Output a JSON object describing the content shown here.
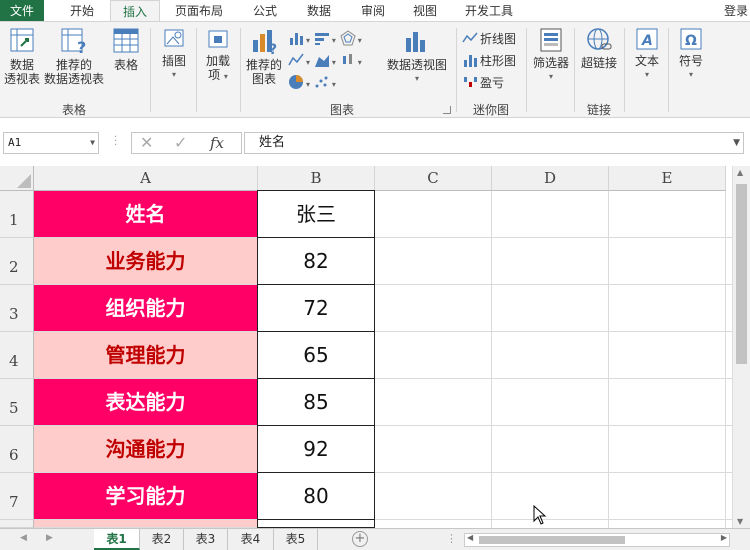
{
  "ribbon_tabs": [
    "文件",
    "开始",
    "插入",
    "页面布局",
    "公式",
    "数据",
    "审阅",
    "视图",
    "开发工具"
  ],
  "login": "登录",
  "groups": {
    "table": {
      "label": "表格",
      "pivot_line1": "数据",
      "pivot_line2": "透视表",
      "rec_pivot_line1": "推荐的",
      "rec_pivot_line2": "数据透视表",
      "table": "表格"
    },
    "illustrations": {
      "label": "插图"
    },
    "addins": {
      "line1": "加载",
      "line2": "项"
    },
    "charts": {
      "label": "图表",
      "rec_chart_line1": "推荐的",
      "rec_chart_line2": "图表",
      "pivot_chart": "数据透视图"
    },
    "sparklines": {
      "label": "迷你图",
      "line": "折线图",
      "column": "柱形图",
      "winloss": "盈亏"
    },
    "filters": {
      "slicer": "筛选器"
    },
    "links": {
      "label": "链接",
      "hyperlink": "超链接"
    },
    "text": {
      "label": "文本"
    },
    "symbols": {
      "label": "符号"
    }
  },
  "formula_bar": {
    "name_box": "A1",
    "fx": "fx",
    "value": "姓名"
  },
  "columns": [
    "A",
    "B",
    "C",
    "D",
    "E"
  ],
  "rows": [
    "1",
    "2",
    "3",
    "4",
    "5",
    "6",
    "7"
  ],
  "cells": {
    "A": [
      "姓名",
      "业务能力",
      "组织能力",
      "管理能力",
      "表达能力",
      "沟通能力",
      "学习能力"
    ],
    "B": [
      "张三",
      "82",
      "72",
      "65",
      "85",
      "92",
      "80"
    ]
  },
  "sheets": [
    "表1",
    "表2",
    "表3",
    "表4",
    "表5"
  ],
  "colors": {
    "header_dark": "#ff0066",
    "row_light": "#ffcccc",
    "light_text": "#c00000",
    "excel_green": "#217346"
  }
}
